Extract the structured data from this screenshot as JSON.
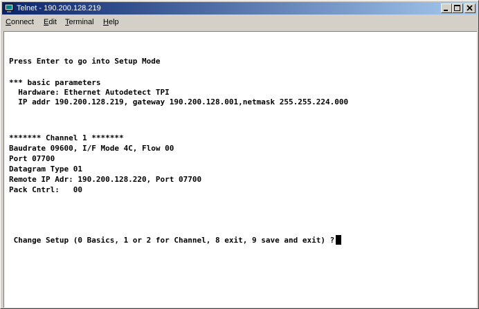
{
  "window": {
    "title": "Telnet - 190.200.128.219",
    "icon": "telnet-icon"
  },
  "menu": {
    "connect": {
      "underline": "C",
      "rest": "onnect"
    },
    "edit": {
      "underline": "E",
      "rest": "dit"
    },
    "terminal": {
      "underline": "T",
      "rest": "erminal"
    },
    "help": {
      "underline": "H",
      "rest": "elp"
    }
  },
  "terminal": {
    "lines": [
      "Press Enter to go into Setup Mode",
      "*** basic parameters",
      "  Hardware: Ethernet Autodetect TPI",
      "  IP addr 190.200.128.219, gateway 190.200.128.001,netmask 255.255.224.000",
      "******* Channel 1 *******",
      "Baudrate 09600, I/F Mode 4C, Flow 00",
      "Port 07700",
      "Datagram Type 01",
      "Remote IP Adr: 190.200.128.220, Port 07700",
      "Pack Cntrl:   00",
      " Change Setup (0 Basics, 1 or 2 for Channel, 8 exit, 9 save and exit) ?"
    ]
  }
}
